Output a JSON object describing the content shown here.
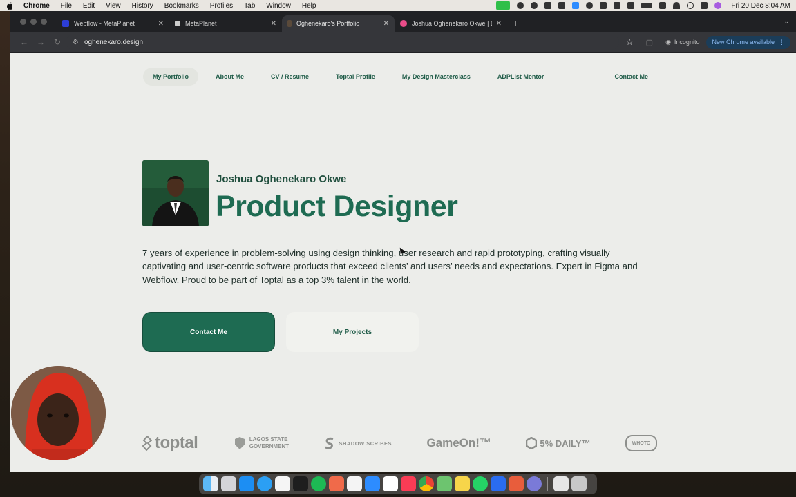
{
  "menubar": {
    "app": "Chrome",
    "items": [
      "File",
      "Edit",
      "View",
      "History",
      "Bookmarks",
      "Profiles",
      "Tab",
      "Window",
      "Help"
    ],
    "clock": "Fri 20 Dec  8:04 AM"
  },
  "tabs": [
    {
      "title": "Webflow - MetaPlanet",
      "color": "#2d3ed6"
    },
    {
      "title": "MetaPlanet",
      "color": "#cccccc"
    },
    {
      "title": "Oghenekaro's Portfolio",
      "color": "#3a2a1f"
    },
    {
      "title": "Joshua Oghenekaro Okwe | D",
      "color": "#ea4c89"
    }
  ],
  "address": {
    "url": "oghenekaro.design"
  },
  "toolbar": {
    "incognito": "Incognito",
    "update": "New Chrome available"
  },
  "nav": {
    "items": [
      "My Portfolio",
      "About Me",
      "CV / Resume",
      "Toptal Profile",
      "My Design Masterclass",
      "ADPList Mentor",
      "Contact Me"
    ]
  },
  "hero": {
    "name": "Joshua Oghenekaro Okwe",
    "role": "Product Designer",
    "intro": "7 years of experience in problem-solving using design thinking, user research and rapid prototyping, crafting visually captivating and user-centric software products that exceed clients’ and users’ needs and expectations. Expert in Figma and Webflow. Proud to be part of Toptal as a top 3% talent in the world.",
    "primary_cta": "Contact Me",
    "secondary_cta": "My Projects"
  },
  "logos": {
    "toptal": "toptal",
    "lagos_1": "LAGOS STATE",
    "lagos_2": "GOVERNMENT",
    "shadow": "SHADOW SCRIBES",
    "gameon": "GameOn!™",
    "daily": "5% DAILY™",
    "stamp": "WHOTO"
  },
  "colors": {
    "brand_green": "#1e6b52",
    "page_bg": "#ecedea"
  }
}
